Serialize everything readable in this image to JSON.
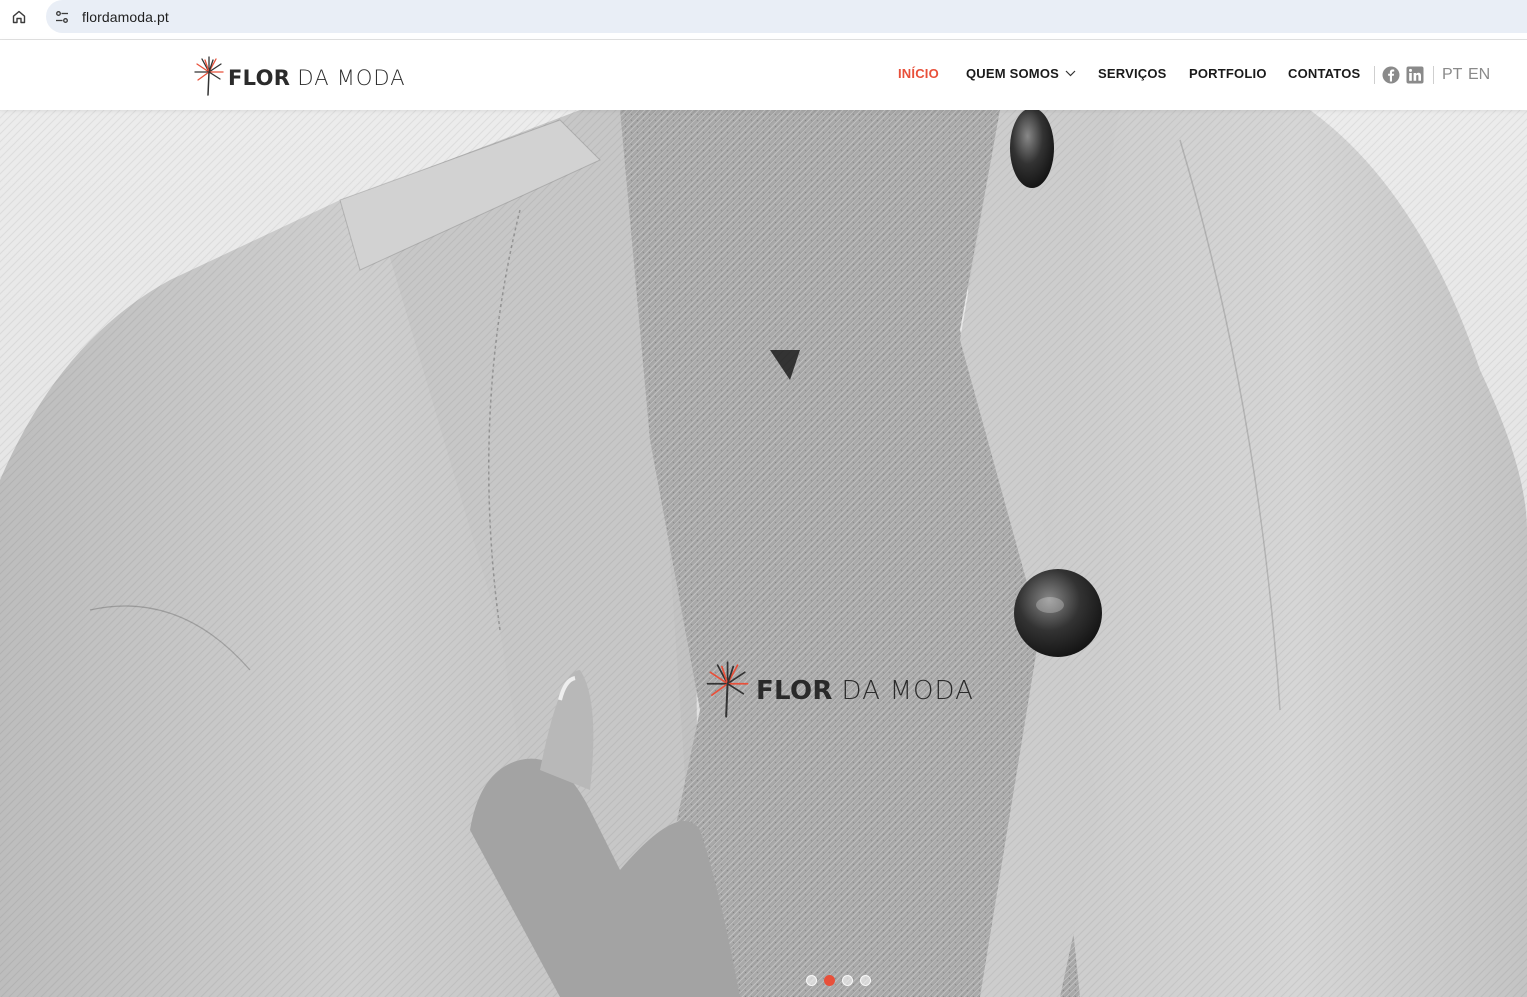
{
  "browser": {
    "url": "flordamoda.pt",
    "icons": {
      "home": "home-icon",
      "site_info": "tune-icon"
    }
  },
  "header": {
    "logo": {
      "word1": "FLOR",
      "word2": "DA",
      "word3": "MODA"
    },
    "nav": [
      {
        "label": "INÍCIO",
        "active": true
      },
      {
        "label": "QUEM SOMOS",
        "has_dropdown": true
      },
      {
        "label": "SERVIÇOS"
      },
      {
        "label": "PORTFOLIO"
      },
      {
        "label": "CONTATOS"
      }
    ],
    "social": [
      {
        "icon": "facebook-icon"
      },
      {
        "icon": "linkedin-icon"
      }
    ],
    "languages": [
      "PT",
      "EN"
    ]
  },
  "hero": {
    "logo": {
      "word1": "FLOR",
      "word2": "DA",
      "word3": "MODA"
    },
    "slides": 4,
    "active_slide": 2
  },
  "colors": {
    "accent": "#e8503a",
    "text": "#1a1a1a",
    "muted": "#8a8a8a",
    "url_bar": "#e9eef6"
  }
}
